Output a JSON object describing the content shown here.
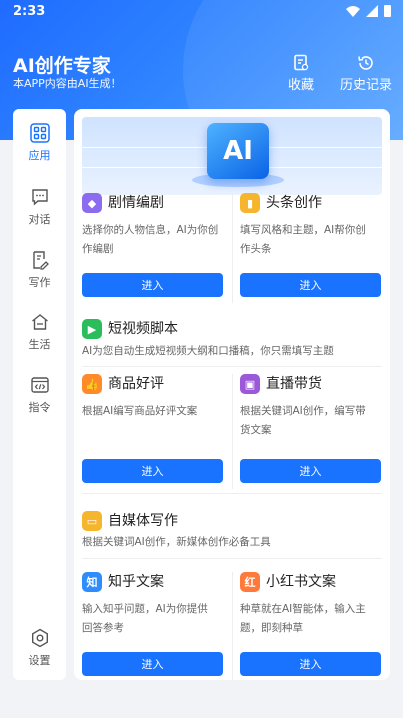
{
  "status_bar": {
    "time": "2:33"
  },
  "header": {
    "title": "AI创作专家",
    "subtitle": "本APP内容由AI生成！",
    "collect_label": "收藏",
    "history_label": "历史记录"
  },
  "sidebar": {
    "items": [
      {
        "label": "应用",
        "icon": "grid-icon",
        "active": true
      },
      {
        "label": "对话",
        "icon": "chat-icon"
      },
      {
        "label": "写作",
        "icon": "write-icon"
      },
      {
        "label": "生活",
        "icon": "home-icon"
      },
      {
        "label": "指令",
        "icon": "code-icon"
      }
    ],
    "settings_label": "设置"
  },
  "banner": {
    "text": "AI"
  },
  "tiles": [
    {
      "title": "剧情编剧",
      "desc_line1": "选择你的人物信息，AI为你创",
      "desc_line2": "作编剧",
      "button": "进入",
      "color": "#8b6cf0"
    },
    {
      "title": "头条创作",
      "desc_line1": "填写风格和主题，AI帮你创",
      "desc_line2": "作头条",
      "button": "进入",
      "color": "#f5b52c"
    },
    {
      "title": "商品好评",
      "desc_line1": "根据AI编写商品好评文案",
      "desc_line2": "",
      "button": "进入",
      "color": "#ff8a2a"
    },
    {
      "title": "直播带货",
      "desc_line1": "根据关键词AI创作，编写带",
      "desc_line2": "货文案",
      "button": "进入",
      "color": "#9b59d9"
    },
    {
      "title": "知乎文案",
      "desc_line1": "输入知乎问题，AI为你提供",
      "desc_line2": "回答参考",
      "button": "进入",
      "color": "#2f8cff"
    },
    {
      "title": "小红书文案",
      "desc_line1": "种草就在AI智能体，输入主",
      "desc_line2": "题，即刻种草",
      "button": "进入",
      "color": "#ff7a3a"
    }
  ],
  "sections": [
    {
      "title": "短视频脚本",
      "desc": "AI为您自动生成短视频大纲和口播稿，你只需填写主题",
      "color": "#2bbd5b"
    },
    {
      "title": "自媒体写作",
      "desc": "根据关键词AI创作，新媒体创作必备工具",
      "color": "#f5b52c"
    }
  ]
}
